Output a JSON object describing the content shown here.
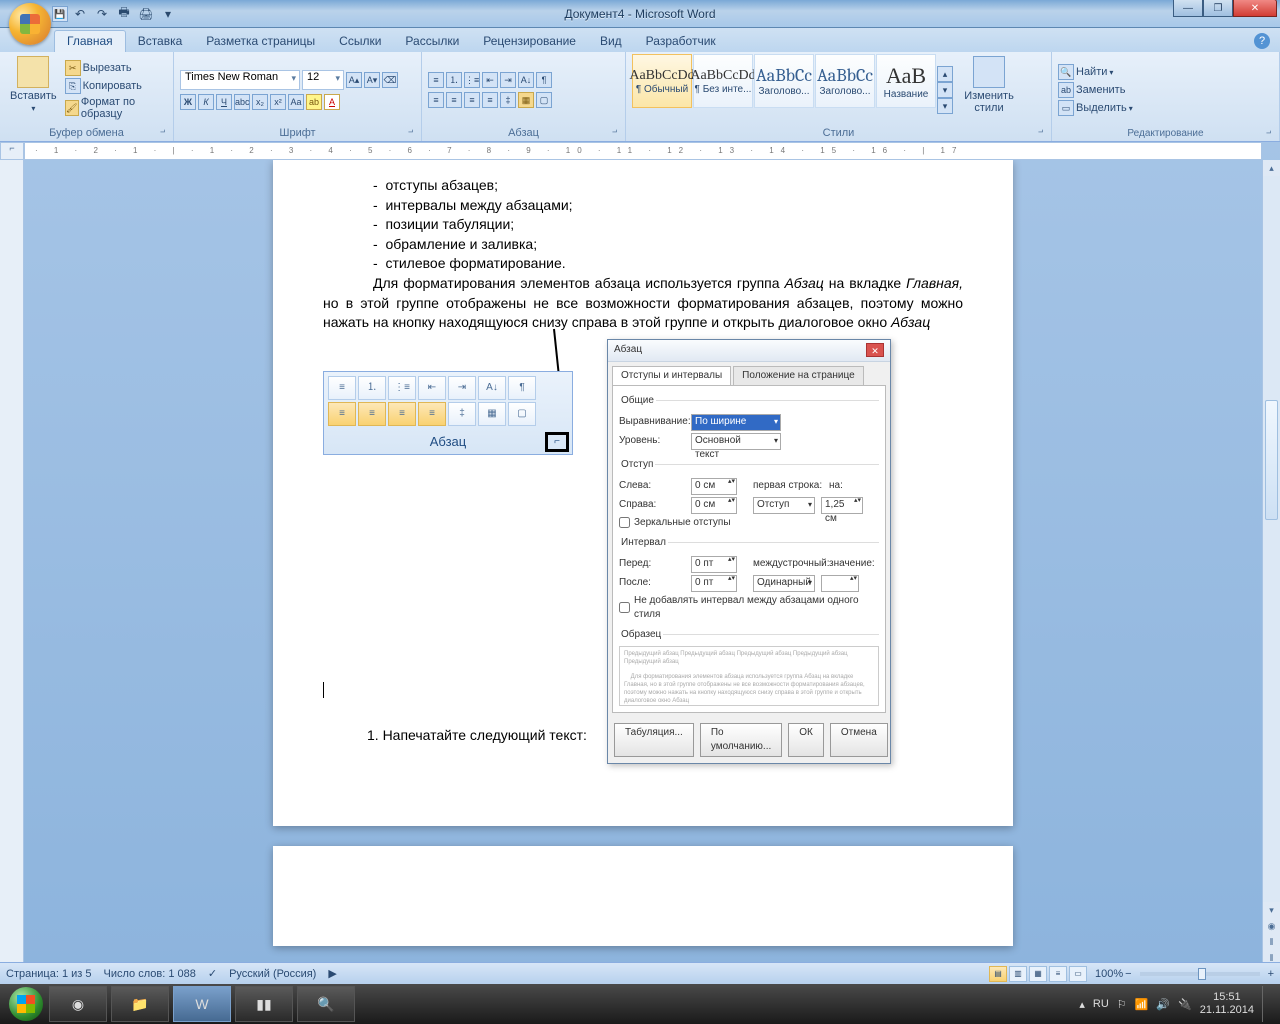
{
  "title": "Документ4 - Microsoft Word",
  "tabs": [
    "Главная",
    "Вставка",
    "Разметка страницы",
    "Ссылки",
    "Рассылки",
    "Рецензирование",
    "Вид",
    "Разработчик"
  ],
  "clipboard": {
    "paste": "Вставить",
    "cut": "Вырезать",
    "copy": "Копировать",
    "painter": "Формат по образцу",
    "label": "Буфер обмена"
  },
  "font": {
    "name": "Times New Roman",
    "size": "12",
    "label": "Шрифт"
  },
  "paragraph": {
    "label": "Абзац"
  },
  "styles": {
    "label": "Стили",
    "items": [
      {
        "sample": "AaBbCcDd",
        "name": "¶ Обычный"
      },
      {
        "sample": "AaBbCcDd",
        "name": "¶ Без инте..."
      },
      {
        "sample": "AaBbCc",
        "name": "Заголово..."
      },
      {
        "sample": "AaBbCc",
        "name": "Заголово..."
      },
      {
        "sample": "АаВ",
        "name": "Название"
      }
    ],
    "change": "Изменить стили"
  },
  "editing": {
    "find": "Найти",
    "replace": "Заменить",
    "select": "Выделить",
    "label": "Редактирование"
  },
  "document": {
    "bullets": [
      "отступы абзацев;",
      "интервалы между абзацами;",
      "позиции табуляции;",
      "обрамление и заливка;",
      "стилевое форматирование."
    ],
    "para1_a": "Для форматирования элементов абзаца используется группа ",
    "para1_i1": "Абзац",
    "para1_b": " на вкладке ",
    "para1_i2": "Главная,",
    "para1_c": " но в этой группе отображены не все возможности форматирования абзацев, поэтому можно нажать на кнопку находящуюся снизу справа в этой группе и открыть диалоговое окно ",
    "para1_i3": "Абзац",
    "inline_label": "Абзац",
    "task": "1.  Напечатайте следующий текст:"
  },
  "dialog": {
    "title": "Абзац",
    "tab1": "Отступы и интервалы",
    "tab2": "Положение на странице",
    "general": "Общие",
    "align_l": "Выравнивание:",
    "align_v": "По ширине",
    "level_l": "Уровень:",
    "level_v": "Основной текст",
    "indent": "Отступ",
    "left_l": "Слева:",
    "left_v": "0 см",
    "right_l": "Справа:",
    "right_v": "0 см",
    "mirror": "Зеркальные отступы",
    "first_l": "первая строка:",
    "first_v": "Отступ",
    "on_l": "на:",
    "on_v": "1,25 см",
    "spacing": "Интервал",
    "before_l": "Перед:",
    "before_v": "0 пт",
    "after_l": "После:",
    "after_v": "0 пт",
    "line_l": "междустрочный:",
    "line_v": "Одинарный",
    "val_l": "значение:",
    "nosame": "Не добавлять интервал между абзацами одного стиля",
    "sample": "Образец",
    "tabs": "Табуляция...",
    "default": "По умолчанию...",
    "ok": "ОК",
    "cancel": "Отмена"
  },
  "status": {
    "page": "Страница: 1 из 5",
    "words": "Число слов: 1 088",
    "lang": "Русский (Россия)",
    "zoom": "100%"
  },
  "tray": {
    "lang": "RU",
    "time": "15:51",
    "date": "21.11.2014"
  }
}
